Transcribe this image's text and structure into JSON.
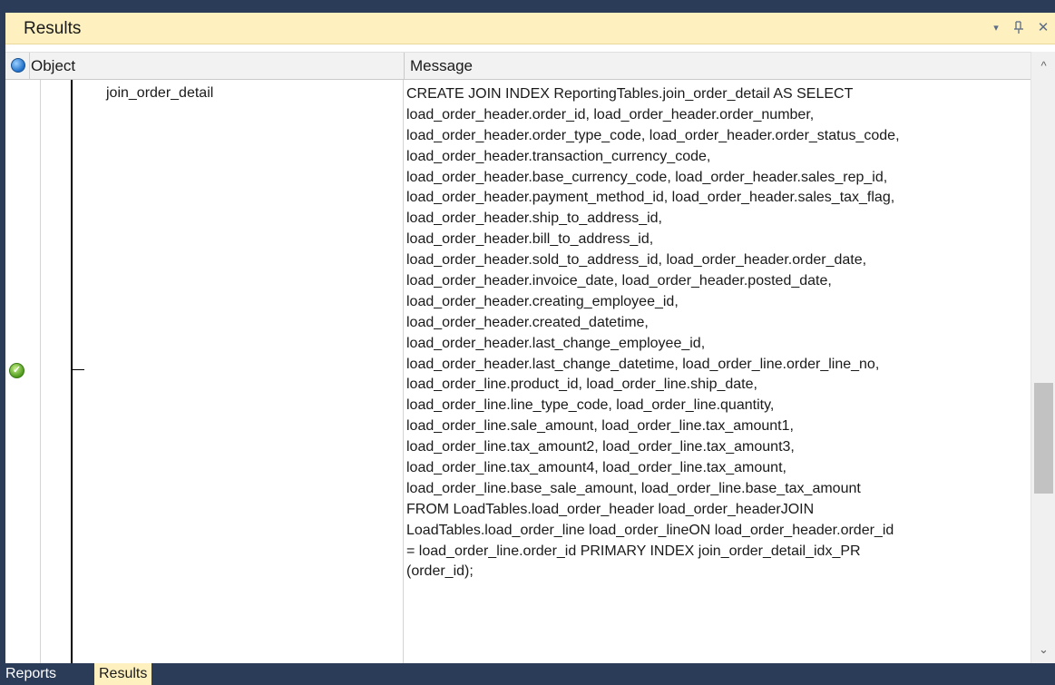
{
  "window": {
    "title": "Results",
    "controls": {
      "dropdown_glyph": "▾",
      "pin_glyph": "ꟼ",
      "close_glyph": "✕"
    }
  },
  "grid": {
    "columns": [
      "Object",
      "Message"
    ],
    "rows": [
      {
        "status_icon": "success-check-icon",
        "object": "join_order_detail",
        "message_lines": [
          "CREATE JOIN INDEX ReportingTables.join_order_detail AS SELECT",
          "load_order_header.order_id, load_order_header.order_number,",
          "load_order_header.order_type_code, load_order_header.order_status_code,",
          "load_order_header.transaction_currency_code,",
          "load_order_header.base_currency_code, load_order_header.sales_rep_id,",
          "load_order_header.payment_method_id, load_order_header.sales_tax_flag,",
          "load_order_header.ship_to_address_id,",
          "load_order_header.bill_to_address_id,",
          "load_order_header.sold_to_address_id, load_order_header.order_date,",
          "load_order_header.invoice_date, load_order_header.posted_date,",
          "load_order_header.creating_employee_id,",
          "load_order_header.created_datetime,",
          "load_order_header.last_change_employee_id,",
          "load_order_header.last_change_datetime, load_order_line.order_line_no,",
          "load_order_line.product_id, load_order_line.ship_date,",
          "load_order_line.line_type_code, load_order_line.quantity,",
          "load_order_line.sale_amount, load_order_line.tax_amount1,",
          "load_order_line.tax_amount2, load_order_line.tax_amount3,",
          "load_order_line.tax_amount4, load_order_line.tax_amount,",
          "load_order_line.base_sale_amount, load_order_line.base_tax_amount",
          "FROM LoadTables.load_order_header load_order_headerJOIN",
          "LoadTables.load_order_line load_order_lineON load_order_header.order_id",
          "= load_order_line.order_id PRIMARY INDEX join_order_detail_idx_PR",
          "(order_id);"
        ]
      }
    ],
    "scrollbar": {
      "up_glyph": "^",
      "down_glyph": "⌄",
      "position_fraction": 0.68
    }
  },
  "tabs": [
    {
      "label": "Reports",
      "active": false
    },
    {
      "label": "Results",
      "active": true
    }
  ],
  "colors": {
    "title_bar": "#fef1bf",
    "frame": "#2b3c59",
    "header_bg": "#f2f2f2",
    "active_tab": "#fef1bf"
  }
}
